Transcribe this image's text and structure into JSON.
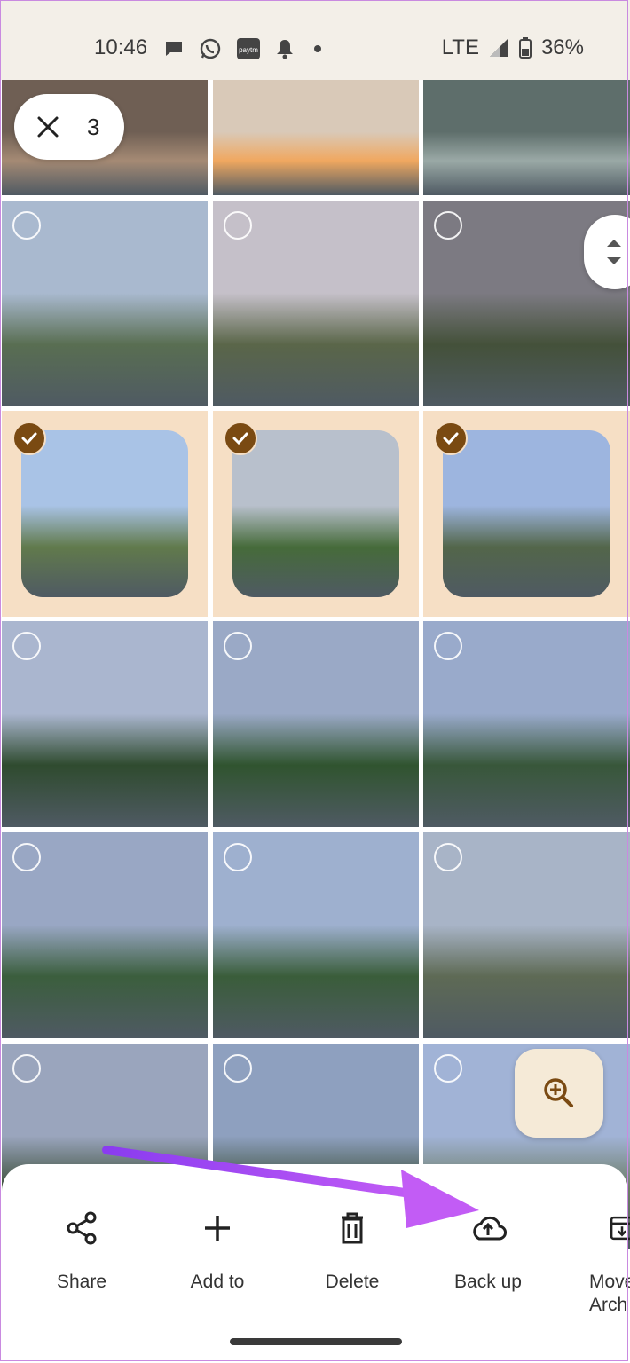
{
  "status": {
    "time": "10:46",
    "network": "LTE",
    "battery": "36%",
    "left_icons": [
      "message-icon",
      "whatsapp-icon",
      "paytm-icon",
      "notification-bell-icon",
      "dot-icon"
    ]
  },
  "selection": {
    "count": "3",
    "close_icon": "close-icon"
  },
  "grid": {
    "columns": 3,
    "photos": [
      {
        "id": "p1",
        "selected": false,
        "has_checkbox": false
      },
      {
        "id": "p2",
        "selected": false,
        "has_checkbox": false
      },
      {
        "id": "p3",
        "selected": false,
        "has_checkbox": false
      },
      {
        "id": "p4",
        "selected": false,
        "has_checkbox": true
      },
      {
        "id": "p5",
        "selected": false,
        "has_checkbox": true
      },
      {
        "id": "p6",
        "selected": false,
        "has_checkbox": true
      },
      {
        "id": "p7",
        "selected": true,
        "has_checkbox": true
      },
      {
        "id": "p8",
        "selected": true,
        "has_checkbox": true
      },
      {
        "id": "p9",
        "selected": true,
        "has_checkbox": true
      },
      {
        "id": "p10",
        "selected": false,
        "has_checkbox": true
      },
      {
        "id": "p11",
        "selected": false,
        "has_checkbox": true
      },
      {
        "id": "p12",
        "selected": false,
        "has_checkbox": true
      },
      {
        "id": "p13",
        "selected": false,
        "has_checkbox": true
      },
      {
        "id": "p14",
        "selected": false,
        "has_checkbox": true
      },
      {
        "id": "p15",
        "selected": false,
        "has_checkbox": true
      },
      {
        "id": "p16",
        "selected": false,
        "has_checkbox": true
      },
      {
        "id": "p17",
        "selected": false,
        "has_checkbox": true
      },
      {
        "id": "p18",
        "selected": false,
        "has_checkbox": true
      }
    ]
  },
  "actions": [
    {
      "label": "Share",
      "icon": "share-icon"
    },
    {
      "label": "Add to",
      "icon": "plus-icon"
    },
    {
      "label": "Delete",
      "icon": "trash-icon"
    },
    {
      "label": "Back up",
      "icon": "cloud-upload-icon"
    },
    {
      "label": "Move to Archive",
      "label_visible": "Move\nArch",
      "icon": "archive-icon"
    }
  ],
  "colors": {
    "selected_bg": "#f6dfc5",
    "check_fill": "#7a4a12",
    "annotation_arrow": "#b84cf2"
  }
}
